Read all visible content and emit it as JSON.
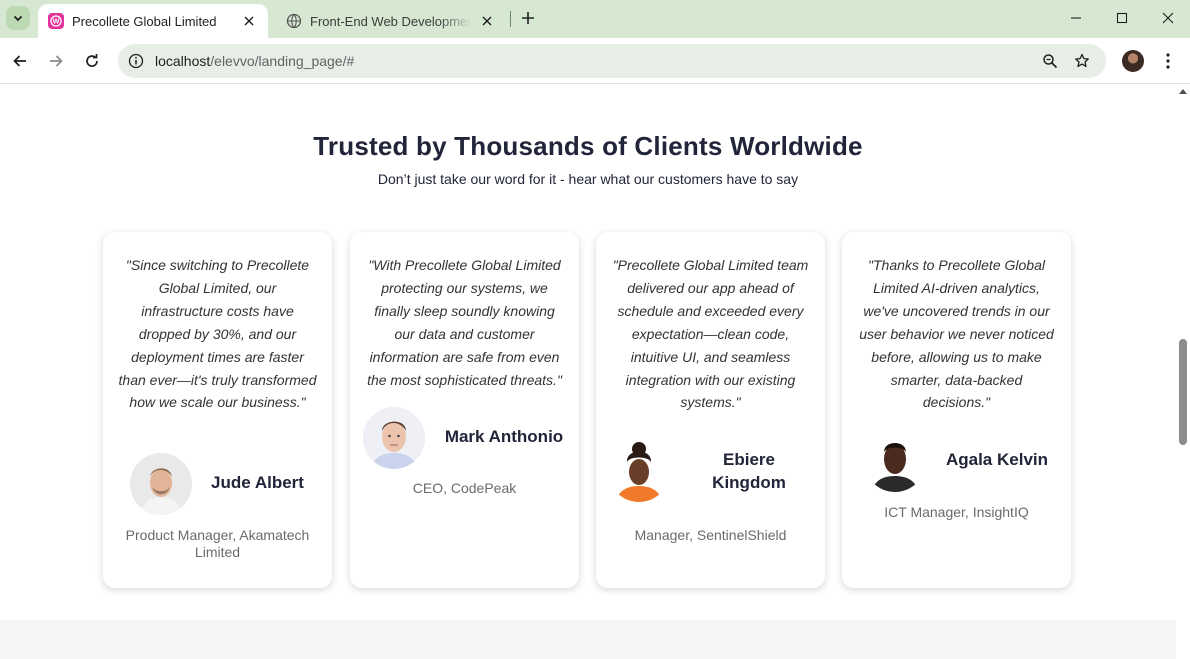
{
  "browser": {
    "tabs": [
      {
        "title": "Precollete Global Limited",
        "active": true,
        "favicon": "wordpress-icon"
      },
      {
        "title": "Front-End Web Development Ta",
        "active": false,
        "favicon": "globe-icon"
      }
    ],
    "url_host": "localhost",
    "url_path": "/elevvo/landing_page/#"
  },
  "testimonials": {
    "title": "Trusted by Thousands of Clients Worldwide",
    "subtitle": "Don’t just take our word for it - hear what our customers have to say",
    "cards": [
      {
        "quote": "\"Since switching to Precollete Global Limited, our infrastructure costs have dropped by 30%, and our deployment times are faster than ever—it's truly transformed how we scale our business.\"",
        "name": "Jude Albert",
        "role": "Product Manager, Akamatech Limited"
      },
      {
        "quote": "\"With Precollete Global Limited protecting our systems, we finally sleep soundly knowing our data and customer information are safe from even the most sophisticated threats.\"",
        "name": "Mark Anthonio",
        "role": "CEO, CodePeak"
      },
      {
        "quote": "\"Precollete Global Limited team delivered our app ahead of schedule and exceeded every expectation—clean code, intuitive UI, and seamless integration with our existing systems.\"",
        "name": "Ebiere Kingdom",
        "role": "Manager, SentinelShield"
      },
      {
        "quote": "\"Thanks to Precollete Global Limited AI-driven analytics, we've uncovered trends in our user behavior we never noticed before, allowing us to make smarter, data-backed decisions.\"",
        "name": "Agala Kelvin",
        "role": "ICT Manager, InsightIQ"
      }
    ]
  }
}
